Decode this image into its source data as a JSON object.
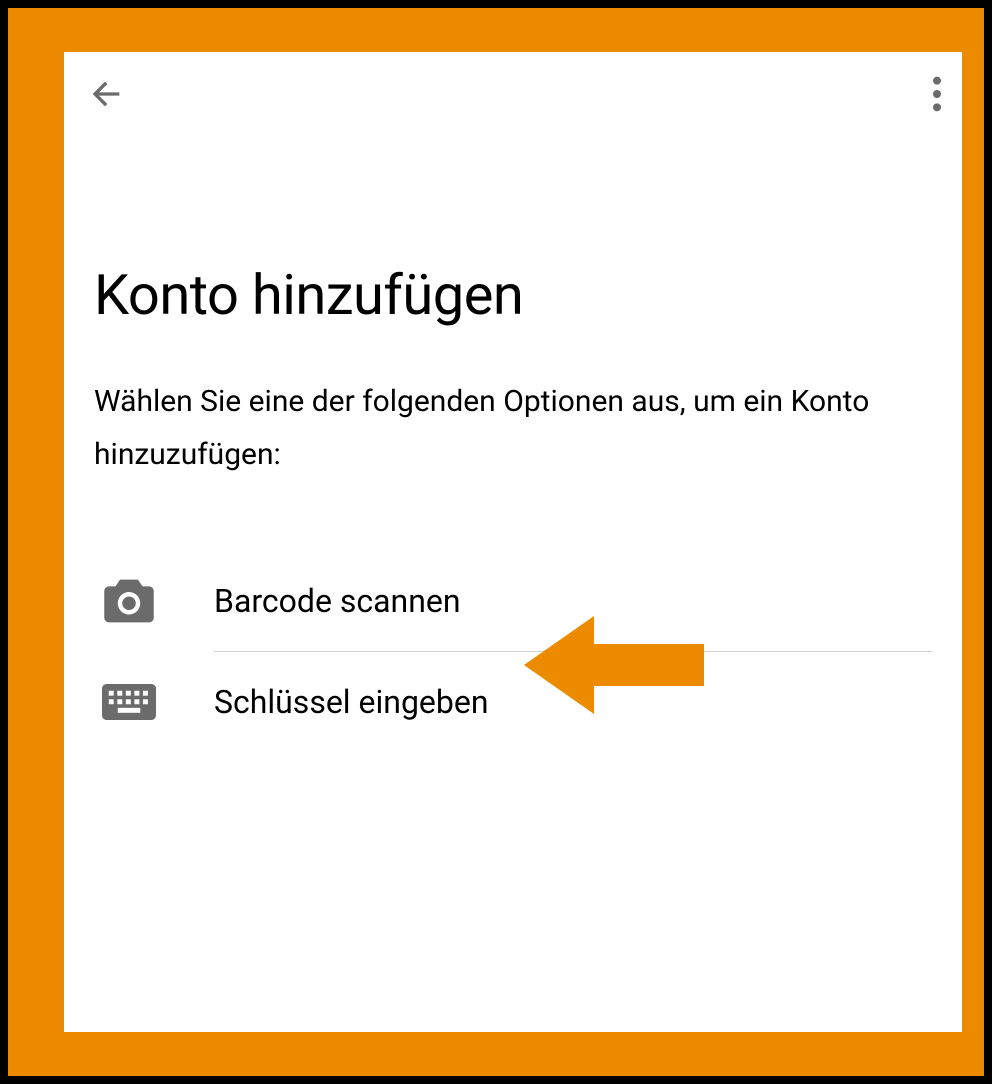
{
  "header": {
    "back_icon": "back-arrow",
    "more_icon": "more-vertical"
  },
  "page": {
    "title": "Konto hinzufügen",
    "description": "Wählen Sie eine der folgenden Optionen aus, um ein Konto hinzuzufügen:"
  },
  "options": [
    {
      "icon": "camera",
      "label": "Barcode scannen"
    },
    {
      "icon": "keyboard",
      "label": "Schlüssel eingeben"
    }
  ],
  "annotation": {
    "arrow_color": "#ed8b00"
  },
  "colors": {
    "frame": "#ed8b00",
    "icon_gray": "#6b6b6b"
  }
}
